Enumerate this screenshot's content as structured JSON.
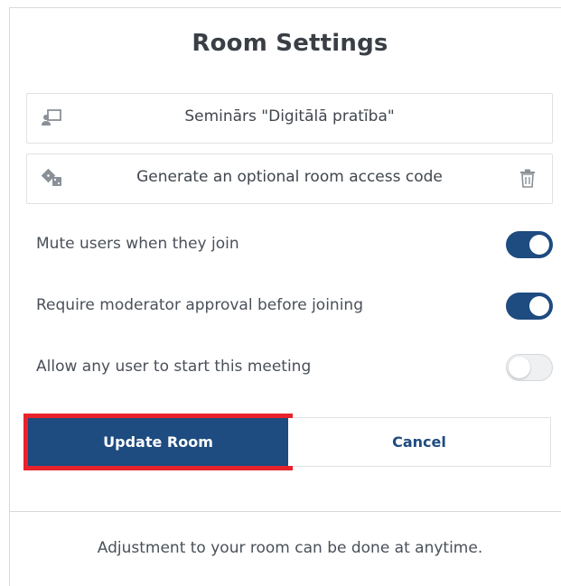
{
  "modal": {
    "title": "Room Settings",
    "room_name": {
      "value": "Seminārs \"Digitālā pratība\"",
      "icon": "presentation-icon"
    },
    "access_code": {
      "placeholder": "Generate an optional room access code",
      "left_icon": "dice-icon",
      "right_icon": "trash-icon"
    },
    "settings": [
      {
        "label": "Mute users when they join",
        "enabled": true
      },
      {
        "label": "Require moderator approval before joining",
        "enabled": true
      },
      {
        "label": "Allow any user to start this meeting",
        "enabled": false
      }
    ],
    "buttons": {
      "update": "Update Room",
      "cancel": "Cancel"
    },
    "footer": "Adjustment to your room can be done at anytime."
  },
  "colors": {
    "primary": "#1e4b80",
    "highlight": "#e8232b",
    "toggle_off": "#eef0f2"
  }
}
